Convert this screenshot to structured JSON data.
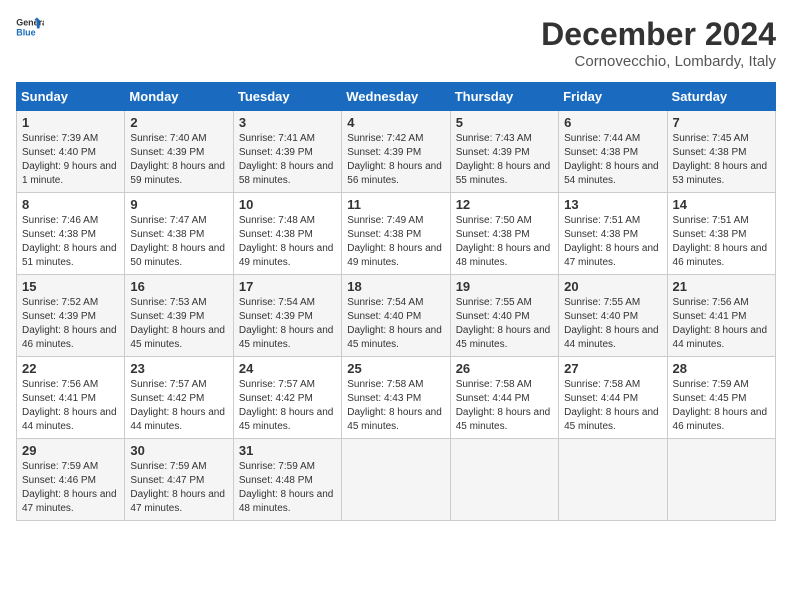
{
  "logo": {
    "general": "General",
    "blue": "Blue"
  },
  "title": "December 2024",
  "location": "Cornovecchio, Lombardy, Italy",
  "days_of_week": [
    "Sunday",
    "Monday",
    "Tuesday",
    "Wednesday",
    "Thursday",
    "Friday",
    "Saturday"
  ],
  "weeks": [
    [
      {
        "day": "1",
        "sunrise": "7:39 AM",
        "sunset": "4:40 PM",
        "daylight": "9 hours and 1 minute."
      },
      {
        "day": "2",
        "sunrise": "7:40 AM",
        "sunset": "4:39 PM",
        "daylight": "8 hours and 59 minutes."
      },
      {
        "day": "3",
        "sunrise": "7:41 AM",
        "sunset": "4:39 PM",
        "daylight": "8 hours and 58 minutes."
      },
      {
        "day": "4",
        "sunrise": "7:42 AM",
        "sunset": "4:39 PM",
        "daylight": "8 hours and 56 minutes."
      },
      {
        "day": "5",
        "sunrise": "7:43 AM",
        "sunset": "4:39 PM",
        "daylight": "8 hours and 55 minutes."
      },
      {
        "day": "6",
        "sunrise": "7:44 AM",
        "sunset": "4:38 PM",
        "daylight": "8 hours and 54 minutes."
      },
      {
        "day": "7",
        "sunrise": "7:45 AM",
        "sunset": "4:38 PM",
        "daylight": "8 hours and 53 minutes."
      }
    ],
    [
      {
        "day": "8",
        "sunrise": "7:46 AM",
        "sunset": "4:38 PM",
        "daylight": "8 hours and 51 minutes."
      },
      {
        "day": "9",
        "sunrise": "7:47 AM",
        "sunset": "4:38 PM",
        "daylight": "8 hours and 50 minutes."
      },
      {
        "day": "10",
        "sunrise": "7:48 AM",
        "sunset": "4:38 PM",
        "daylight": "8 hours and 49 minutes."
      },
      {
        "day": "11",
        "sunrise": "7:49 AM",
        "sunset": "4:38 PM",
        "daylight": "8 hours and 49 minutes."
      },
      {
        "day": "12",
        "sunrise": "7:50 AM",
        "sunset": "4:38 PM",
        "daylight": "8 hours and 48 minutes."
      },
      {
        "day": "13",
        "sunrise": "7:51 AM",
        "sunset": "4:38 PM",
        "daylight": "8 hours and 47 minutes."
      },
      {
        "day": "14",
        "sunrise": "7:51 AM",
        "sunset": "4:38 PM",
        "daylight": "8 hours and 46 minutes."
      }
    ],
    [
      {
        "day": "15",
        "sunrise": "7:52 AM",
        "sunset": "4:39 PM",
        "daylight": "8 hours and 46 minutes."
      },
      {
        "day": "16",
        "sunrise": "7:53 AM",
        "sunset": "4:39 PM",
        "daylight": "8 hours and 45 minutes."
      },
      {
        "day": "17",
        "sunrise": "7:54 AM",
        "sunset": "4:39 PM",
        "daylight": "8 hours and 45 minutes."
      },
      {
        "day": "18",
        "sunrise": "7:54 AM",
        "sunset": "4:40 PM",
        "daylight": "8 hours and 45 minutes."
      },
      {
        "day": "19",
        "sunrise": "7:55 AM",
        "sunset": "4:40 PM",
        "daylight": "8 hours and 45 minutes."
      },
      {
        "day": "20",
        "sunrise": "7:55 AM",
        "sunset": "4:40 PM",
        "daylight": "8 hours and 44 minutes."
      },
      {
        "day": "21",
        "sunrise": "7:56 AM",
        "sunset": "4:41 PM",
        "daylight": "8 hours and 44 minutes."
      }
    ],
    [
      {
        "day": "22",
        "sunrise": "7:56 AM",
        "sunset": "4:41 PM",
        "daylight": "8 hours and 44 minutes."
      },
      {
        "day": "23",
        "sunrise": "7:57 AM",
        "sunset": "4:42 PM",
        "daylight": "8 hours and 44 minutes."
      },
      {
        "day": "24",
        "sunrise": "7:57 AM",
        "sunset": "4:42 PM",
        "daylight": "8 hours and 45 minutes."
      },
      {
        "day": "25",
        "sunrise": "7:58 AM",
        "sunset": "4:43 PM",
        "daylight": "8 hours and 45 minutes."
      },
      {
        "day": "26",
        "sunrise": "7:58 AM",
        "sunset": "4:44 PM",
        "daylight": "8 hours and 45 minutes."
      },
      {
        "day": "27",
        "sunrise": "7:58 AM",
        "sunset": "4:44 PM",
        "daylight": "8 hours and 45 minutes."
      },
      {
        "day": "28",
        "sunrise": "7:59 AM",
        "sunset": "4:45 PM",
        "daylight": "8 hours and 46 minutes."
      }
    ],
    [
      {
        "day": "29",
        "sunrise": "7:59 AM",
        "sunset": "4:46 PM",
        "daylight": "8 hours and 47 minutes."
      },
      {
        "day": "30",
        "sunrise": "7:59 AM",
        "sunset": "4:47 PM",
        "daylight": "8 hours and 47 minutes."
      },
      {
        "day": "31",
        "sunrise": "7:59 AM",
        "sunset": "4:48 PM",
        "daylight": "8 hours and 48 minutes."
      },
      null,
      null,
      null,
      null
    ]
  ]
}
